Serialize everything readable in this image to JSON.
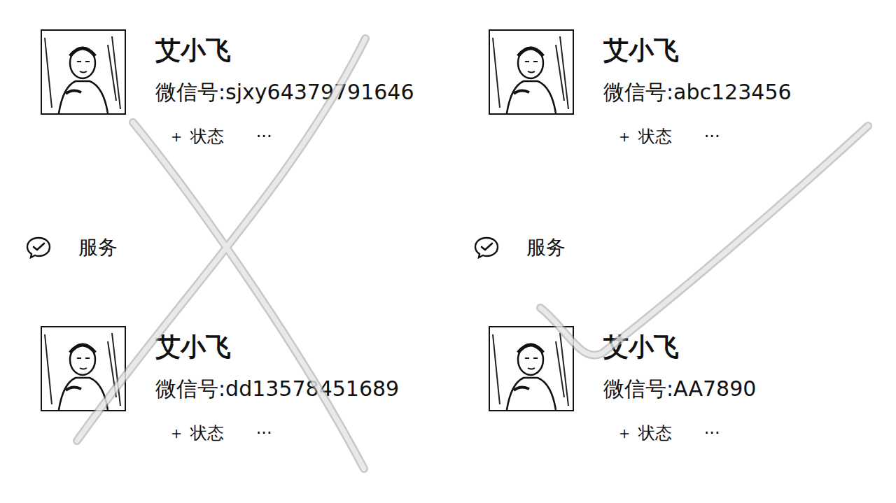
{
  "columns": [
    {
      "mark": "cross",
      "top": {
        "name": "艾小飞",
        "id_label": "微信号:",
        "id": "sjxy64379791646",
        "status": "＋ 状态",
        "more": "···"
      },
      "service": "服务",
      "bottom": {
        "name": "艾小飞",
        "id_label": "微信号:",
        "id": "dd13578451689",
        "status": "＋ 状态",
        "more": "···"
      }
    },
    {
      "mark": "check",
      "top": {
        "name": "艾小飞",
        "id_label": "微信号:",
        "id": "abc123456",
        "status": "＋ 状态",
        "more": "···"
      },
      "service": "服务",
      "bottom": {
        "name": "艾小飞",
        "id_label": "微信号:",
        "id": "AA7890",
        "status": "＋ 状态",
        "more": "···"
      }
    }
  ]
}
